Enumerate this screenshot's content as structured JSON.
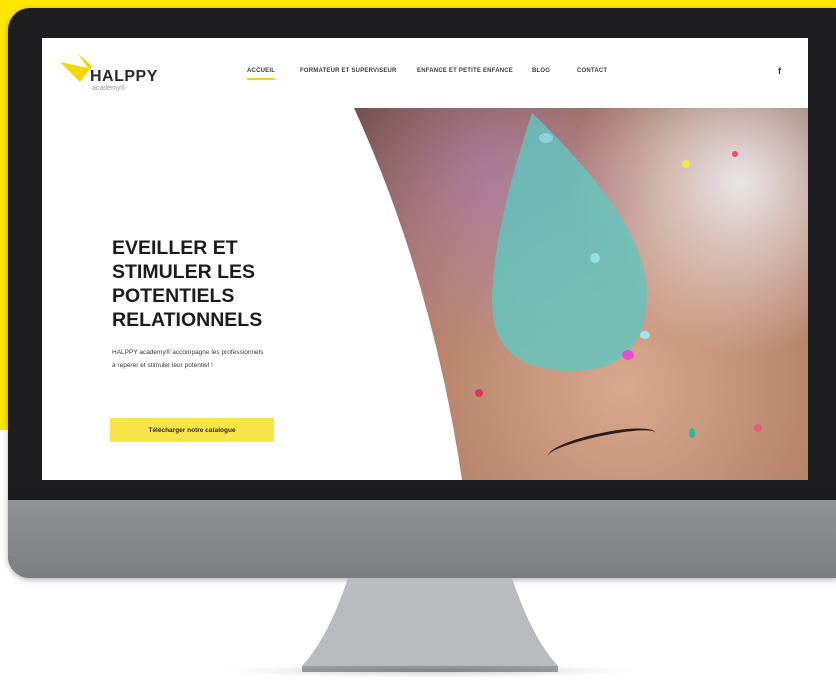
{
  "brand": {
    "name": "HALPPY",
    "sub": "academy®",
    "accent": "#f9e547"
  },
  "nav": {
    "items": [
      "ACCUEIL",
      "FORMATEUR ET SUPERVISEUR",
      "ENFANCE ET PETITE ENFANCE",
      "BLOG",
      "CONTACT"
    ],
    "active": "ACCUEIL",
    "social_icon": "f"
  },
  "hero": {
    "title_lines": [
      "EVEILLER ET",
      "STIMULER LES",
      "POTENTIELS",
      "RELATIONNELS"
    ],
    "desc_lines": [
      "HALPPY academy® accompagne les professionnels",
      "à repérer et stimuler leur potentiel !"
    ],
    "cta_label": "Télécharger notre catalogue"
  },
  "colors": {
    "frame_yellow": "#ffe600",
    "monitor_black": "#1d1d1f",
    "drop_teal": "#5ec8c2"
  }
}
